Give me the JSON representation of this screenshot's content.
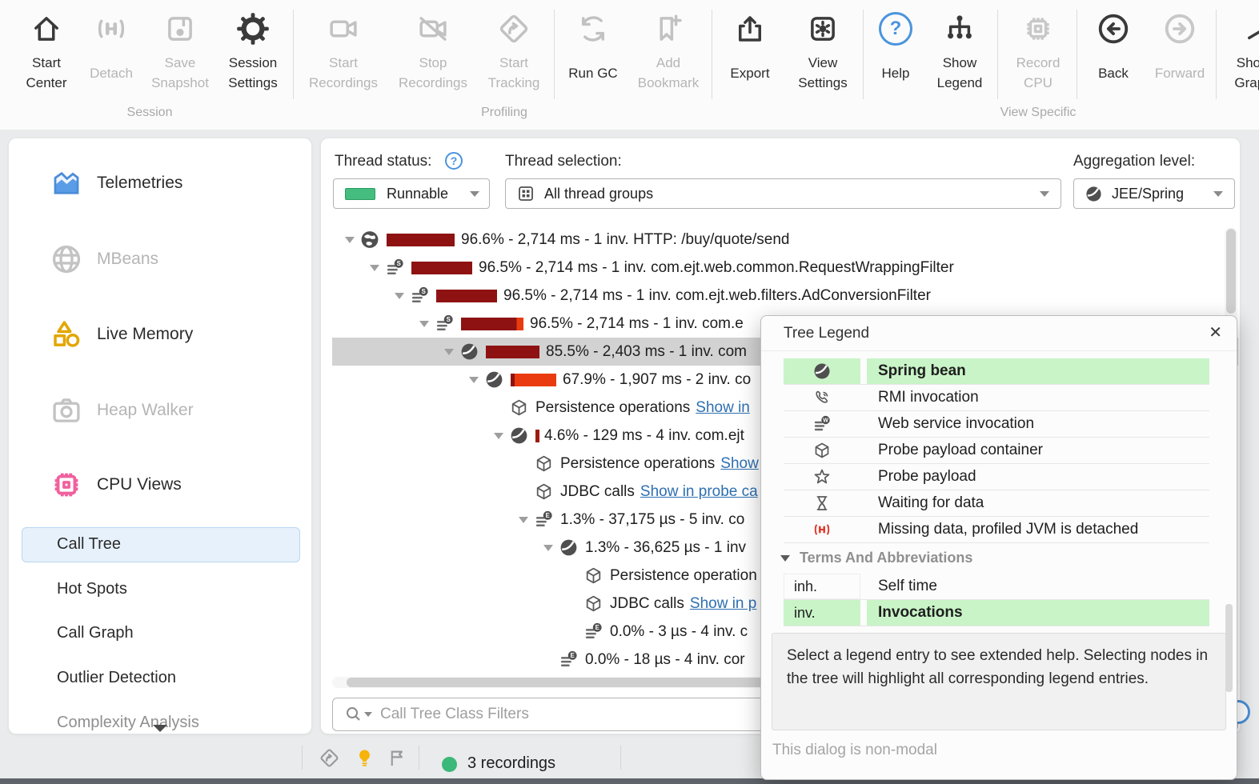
{
  "toolbar": {
    "start_center": "Start\nCenter",
    "detach": "Detach",
    "save_snapshot": "Save\nSnapshot",
    "session_settings": "Session\nSettings",
    "start_recordings": "Start\nRecordings",
    "stop_recordings": "Stop\nRecordings",
    "start_tracking": "Start\nTracking",
    "run_gc": "Run GC",
    "add_bookmark": "Add\nBookmark",
    "export": "Export",
    "view_settings": "View\nSettings",
    "help": "Help",
    "show_legend": "Show\nLegend",
    "record_cpu": "Record\nCPU",
    "back": "Back",
    "forward": "Forward",
    "show_graph": "Show\nGraph",
    "groups": {
      "session": "Session",
      "profiling": "Profiling",
      "view_specific": "View Specific"
    }
  },
  "sidebar": {
    "telemetries": "Telemetries",
    "mbeans": "MBeans",
    "live_memory": "Live Memory",
    "heap_walker": "Heap Walker",
    "cpu_views": "CPU Views",
    "call_tree": "Call Tree",
    "hot_spots": "Hot Spots",
    "call_graph": "Call Graph",
    "outlier_detection": "Outlier Detection",
    "complexity_analysis": "Complexity Analysis"
  },
  "controls": {
    "thread_status_label": "Thread status:",
    "thread_status_value": "Runnable",
    "thread_selection_label": "Thread selection:",
    "thread_selection_value": "All thread groups",
    "aggregation_label": "Aggregation level:",
    "aggregation_value": "JEE/Spring"
  },
  "tree": {
    "rows": [
      {
        "text": "96.6% - 2,714 ms - 1 inv. HTTP: /buy/quote/send"
      },
      {
        "text": "96.5% - 2,714 ms - 1 inv. com.ejt.web.common.RequestWrappingFilter"
      },
      {
        "text": "96.5% - 2,714 ms - 1 inv. com.ejt.web.filters.AdConversionFilter"
      },
      {
        "text": "96.5% - 2,714 ms - 1 inv. com.e"
      },
      {
        "text": "85.5% - 2,403 ms - 1 inv. com"
      },
      {
        "text": "67.9% - 1,907 ms - 2 inv. co"
      },
      {
        "text": "Persistence operations",
        "link": "Show in"
      },
      {
        "text": "4.6% - 129 ms - 4 inv. com.ejt"
      },
      {
        "text": "Persistence operations",
        "link": "Show"
      },
      {
        "text": "JDBC calls",
        "link": "Show in probe ca"
      },
      {
        "text": "1.3% - 37,175 µs - 5 inv. co"
      },
      {
        "text": "1.3% - 36,625 µs - 1 inv"
      },
      {
        "text": "Persistence operation"
      },
      {
        "text": "JDBC calls",
        "link": "Show in p"
      },
      {
        "text": "0.0% - 3 µs - 4 inv. c"
      },
      {
        "text": "0.0% - 18 µs - 4 inv. cor"
      }
    ]
  },
  "legend": {
    "title": "Tree Legend",
    "entries": [
      {
        "icon": "spring-bean",
        "label": "Spring bean"
      },
      {
        "icon": "rmi-phone",
        "label": "RMI invocation"
      },
      {
        "icon": "web-service",
        "label": "Web service invocation"
      },
      {
        "icon": "probe-container",
        "label": "Probe payload container"
      },
      {
        "icon": "probe-payload-star",
        "label": "Probe payload"
      },
      {
        "icon": "hourglass",
        "label": "Waiting for data"
      },
      {
        "icon": "detach-red",
        "label": "Missing data, profiled JVM is detached"
      }
    ],
    "terms_header": "Terms And Abbreviations",
    "terms": [
      {
        "abbr": "inh.",
        "label": "Self time"
      },
      {
        "abbr": "inv.",
        "label": "Invocations"
      }
    ],
    "help_text": "Select a legend entry to see extended help. Selecting nodes in the tree will highlight all corresponding legend entries.",
    "modal_note": "This dialog is non-modal"
  },
  "filter": {
    "placeholder": "Call Tree Class Filters"
  },
  "statusbar": {
    "recordings": "3 recordings"
  },
  "colors": {
    "highlight_green": "#c9f4c7",
    "bar_dark_red": "#8e1212",
    "bar_orange": "#ea3b10",
    "link_blue": "#2e6fb0",
    "runnable_green": "#45bd7f",
    "selected_row_gray": "#d2d2d2",
    "help_blue": "#4a94dd",
    "cpu_pink": "#f0609e",
    "memory_gold": "#e3a600",
    "detach_red": "#e23b2e",
    "recording_green": "#3cb878"
  }
}
